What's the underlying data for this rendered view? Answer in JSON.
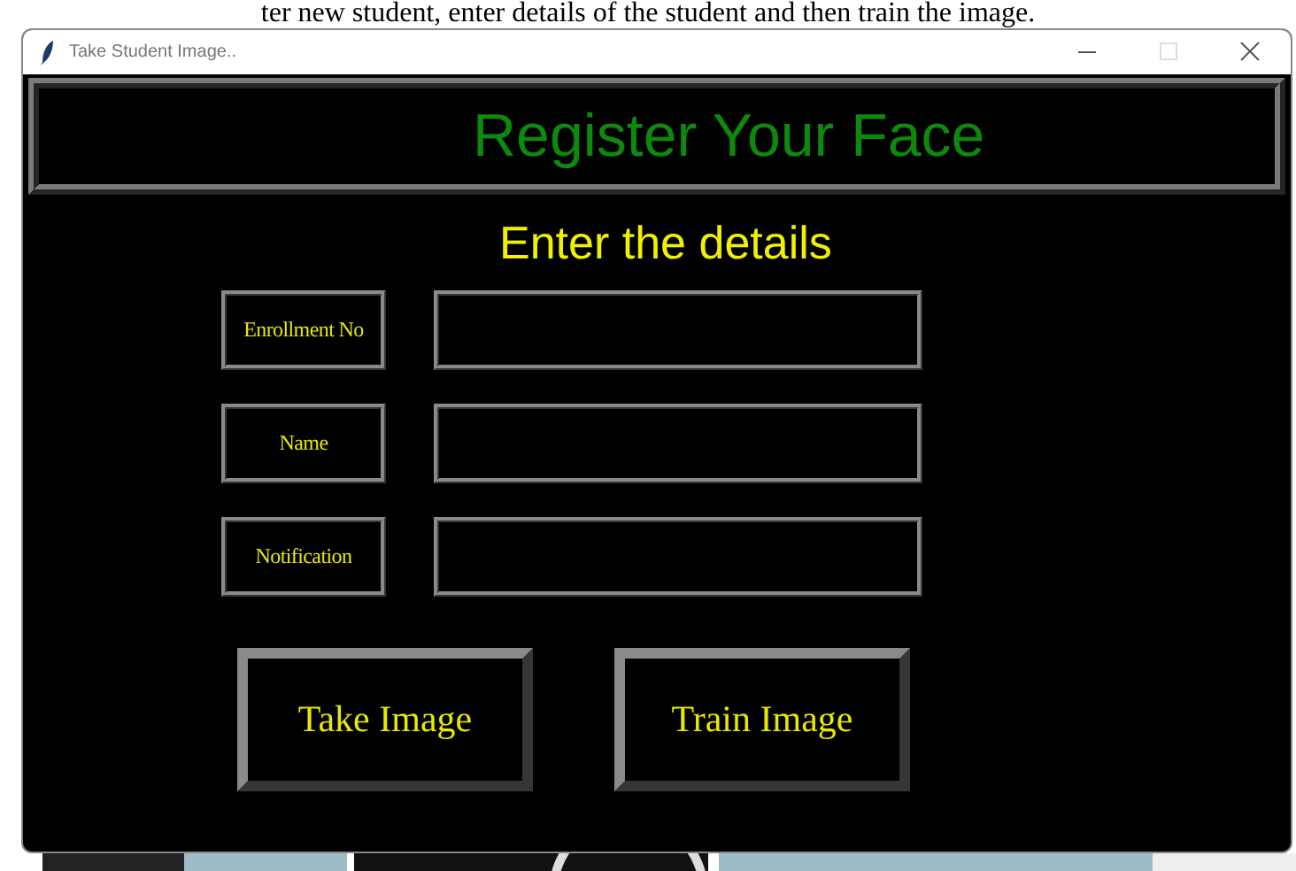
{
  "document_text": "ter new student, enter details of the student and then train the image.",
  "window": {
    "title": "Take Student Image.."
  },
  "header": {
    "title": "Register Your Face"
  },
  "form": {
    "title": "Enter the details",
    "fields": [
      {
        "label": "Enrollment No"
      },
      {
        "label": "Name"
      },
      {
        "label": "Notification"
      }
    ]
  },
  "buttons": [
    "Take Image",
    "Train Image"
  ]
}
